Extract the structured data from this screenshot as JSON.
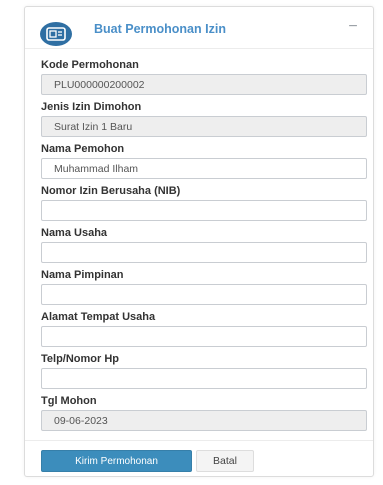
{
  "header": {
    "title": "Buat Permohonan Izin",
    "icon": "id-card-icon",
    "collapse_label": "−"
  },
  "fields": {
    "kode_permohonan": {
      "label": "Kode Permohonan",
      "value": "PLU000000200002"
    },
    "jenis_izin": {
      "label": "Jenis Izin Dimohon",
      "value": "Surat Izin 1 Baru"
    },
    "nama_pemohon": {
      "label": "Nama Pemohon",
      "value": "Muhammad Ilham"
    },
    "nib": {
      "label": "Nomor Izin Berusaha (NIB)",
      "value": ""
    },
    "nama_usaha": {
      "label": "Nama Usaha",
      "value": ""
    },
    "nama_pimpinan": {
      "label": "Nama Pimpinan",
      "value": ""
    },
    "alamat_usaha": {
      "label": "Alamat Tempat Usaha",
      "value": ""
    },
    "telp": {
      "label": "Telp/Nomor Hp",
      "value": ""
    },
    "tgl_mohon": {
      "label": "Tgl Mohon",
      "value": "09-06-2023"
    }
  },
  "buttons": {
    "submit_label": "Kirim Permohonan",
    "cancel_label": "Batal"
  },
  "colors": {
    "accent": "#3c8dbc",
    "title": "#4a8fc8",
    "icon_bg": "#2f6fa3"
  }
}
